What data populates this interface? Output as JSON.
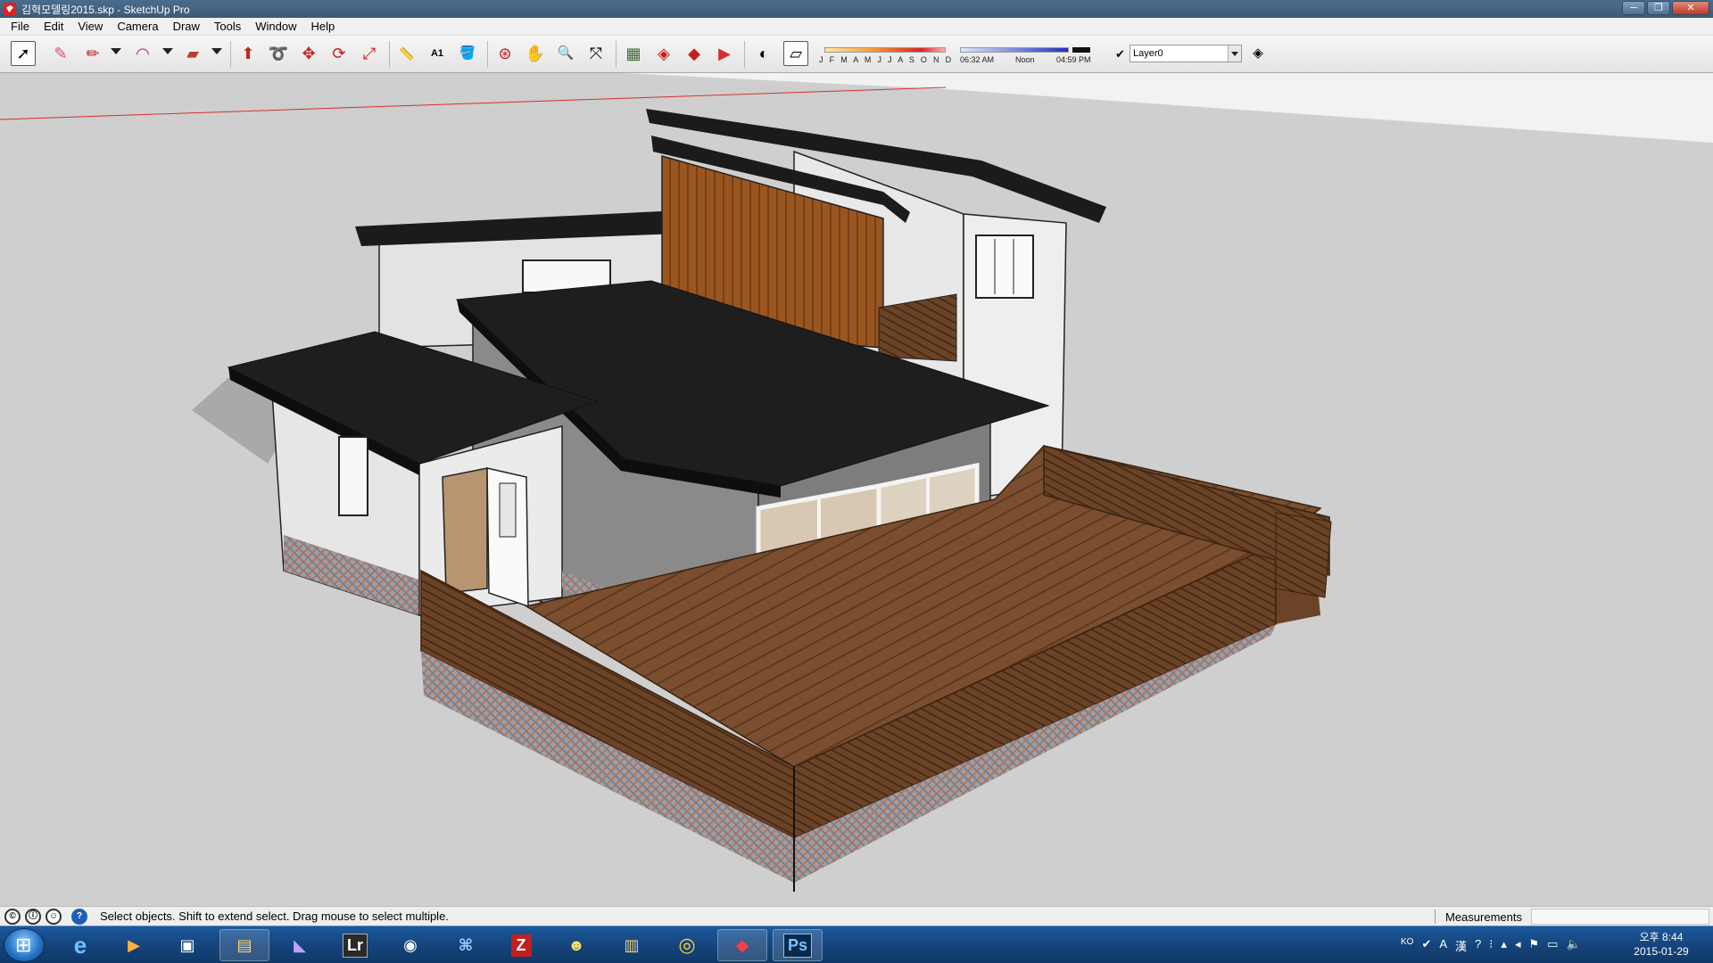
{
  "window": {
    "title": "김혁모델링2015.skp - SketchUp Pro",
    "controls": [
      "─",
      "❐",
      "✕"
    ]
  },
  "menu": [
    "File",
    "Edit",
    "View",
    "Camera",
    "Draw",
    "Tools",
    "Window",
    "Help"
  ],
  "toolbar": {
    "tools": [
      {
        "id": "select",
        "icon": "arrow-select-icon",
        "glyph": "➚"
      },
      {
        "id": "eraser",
        "icon": "eraser-icon",
        "glyph": "✎"
      },
      {
        "id": "pencil",
        "icon": "pencil-icon",
        "glyph": "✏"
      },
      {
        "id": "arc",
        "icon": "arc-icon",
        "glyph": "◠"
      },
      {
        "id": "rectangle",
        "icon": "rectangle-icon",
        "glyph": "▰"
      },
      {
        "id": "push-pull",
        "icon": "push-pull-icon",
        "glyph": "⬆"
      },
      {
        "id": "follow-me",
        "icon": "follow-me-icon",
        "glyph": "➰"
      },
      {
        "id": "move",
        "icon": "move-icon",
        "glyph": "✥"
      },
      {
        "id": "rotate",
        "icon": "rotate-icon",
        "glyph": "⟳"
      },
      {
        "id": "scale",
        "icon": "scale-icon",
        "glyph": "⤢"
      },
      {
        "id": "tape-measure",
        "icon": "tape-measure-icon",
        "glyph": "📏"
      },
      {
        "id": "text",
        "icon": "text-icon",
        "glyph": "A1"
      },
      {
        "id": "paint-bucket",
        "icon": "paint-bucket-icon",
        "glyph": "🪣"
      },
      {
        "id": "orbit",
        "icon": "orbit-icon",
        "glyph": "⊛"
      },
      {
        "id": "pan",
        "icon": "pan-hand-icon",
        "glyph": "✋"
      },
      {
        "id": "zoom",
        "icon": "zoom-icon",
        "glyph": "🔍"
      },
      {
        "id": "zoom-extents",
        "icon": "zoom-extents-icon",
        "glyph": "⤧"
      },
      {
        "id": "3d-warehouse",
        "icon": "warehouse-icon",
        "glyph": "▦"
      },
      {
        "id": "get-models",
        "icon": "get-models-icon",
        "glyph": "◈"
      },
      {
        "id": "share-model",
        "icon": "share-model-icon",
        "glyph": "◆"
      },
      {
        "id": "extension",
        "icon": "extension-icon",
        "glyph": "▶"
      },
      {
        "id": "shadow-settings",
        "icon": "shadow-settings-icon",
        "glyph": "◐"
      },
      {
        "id": "shadows-toggle",
        "icon": "shadows-toggle-icon",
        "glyph": "▱"
      }
    ],
    "months_label": "J F M A M J J A S O N D",
    "time_start": "06:32 AM",
    "time_mid": "Noon",
    "time_end": "04:59 PM",
    "layer_check": "✔",
    "layer": "Layer0",
    "layer_manager_icon": "layer-manager-icon"
  },
  "status": {
    "text": "Select objects. Shift to extend select. Drag mouse to select multiple.",
    "measurements_label": "Measurements",
    "measurements_value": "",
    "icons": [
      "©",
      "ⓘ",
      "☺",
      "?"
    ]
  },
  "taskbar": {
    "apps": [
      {
        "icon": "internet-explorer-icon",
        "glyph": "e"
      },
      {
        "icon": "media-player-icon",
        "glyph": "▶"
      },
      {
        "icon": "photo-viewer-icon",
        "glyph": "▣"
      },
      {
        "icon": "file-explorer-icon",
        "glyph": "▤"
      },
      {
        "icon": "visual-studio-icon",
        "glyph": "◣"
      },
      {
        "icon": "lightroom-icon",
        "glyph": "Lr"
      },
      {
        "icon": "camera-icon",
        "glyph": "◉"
      },
      {
        "icon": "network-icon",
        "glyph": "⌘"
      },
      {
        "icon": "filezilla-icon",
        "glyph": "Z"
      },
      {
        "icon": "qq-icon",
        "glyph": "☻"
      },
      {
        "icon": "archive-icon",
        "glyph": "▥"
      },
      {
        "icon": "chrome-icon",
        "glyph": "◎"
      },
      {
        "icon": "sketchup-icon",
        "glyph": "◆"
      },
      {
        "icon": "photoshop-icon",
        "glyph": "Ps"
      }
    ],
    "tray": [
      "KO",
      "✔",
      "A",
      "漢",
      "?",
      "⁝",
      "▴",
      "◂",
      "⚑",
      "▭",
      "🔈"
    ],
    "clock_ampm": "오후 8:44",
    "clock_date": "2015-01-29"
  },
  "colors": {
    "roof": "#1b1b1b",
    "wall": "#e6e6e6",
    "wall_shade": "#7e7e7e",
    "wood_siding": "#9a5620",
    "deck": "#7a4e2e",
    "deck_rail": "#6b4327",
    "ground": "#cfcfcf"
  }
}
